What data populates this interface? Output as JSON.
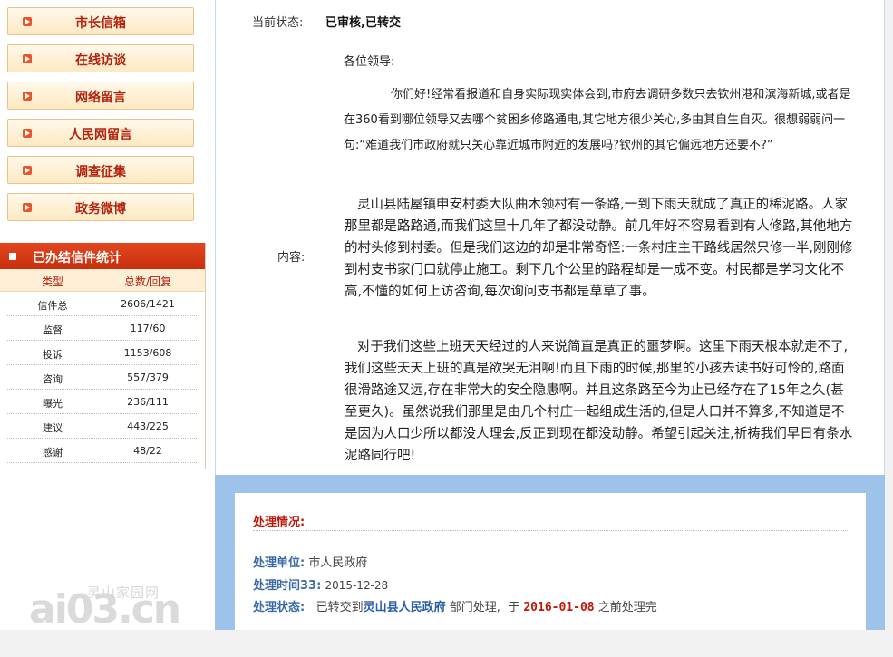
{
  "sidebar": {
    "nav": [
      {
        "label": "市长信箱"
      },
      {
        "label": "在线访谈"
      },
      {
        "label": "网络留言"
      },
      {
        "label": "人民网留言"
      },
      {
        "label": "调查征集"
      },
      {
        "label": "政务微博"
      }
    ],
    "stats": {
      "title": "已办结信件统计",
      "col_type": "类型",
      "col_total": "总数/回复",
      "rows": [
        {
          "type": "信件总",
          "value": "2606/1421"
        },
        {
          "type": "监督",
          "value": "117/60"
        },
        {
          "type": "投诉",
          "value": "1153/608"
        },
        {
          "type": "咨询",
          "value": "557/379"
        },
        {
          "type": "曝光",
          "value": "236/111"
        },
        {
          "type": "建议",
          "value": "443/225"
        },
        {
          "type": "感谢",
          "value": "48/22"
        }
      ]
    }
  },
  "letter": {
    "status_label": "当前状态:",
    "status_value": "已审核,已转交",
    "content_label": "内容:",
    "greeting": "各位领导:",
    "para1": "你们好!经常看报道和自身实际现实体会到,市府去调研多数只去钦州港和滨海新城,或者是在360看到哪位领导又去哪个贫困乡修路通电,其它地方很少关心,多由其自生自灭。很想弱弱问一句:“难道我们市政府就只关心靠近城市附近的发展吗?钦州的其它偏远地方还要不?”",
    "para2": "灵山县陆屋镇申安村委大队曲木领村有一条路,一到下雨天就成了真正的稀泥路。人家那里都是路路通,而我们这里十几年了都没动静。前几年好不容易看到有人修路,其他地方的村头修到村委。但是我们这边的却是非常奇怪:一条村庄主干路线居然只修一半,刚刚修到村支书家门口就停止施工。剩下几个公里的路程却是一成不变。村民都是学习文化不高,不懂的如何上访咨询,每次询问支书都是草草了事。",
    "para3": "对于我们这些上班天天经过的人来说简直是真正的噩梦啊。这里下雨天根本就走不了,我们这些天天上班的真是欲哭无泪啊!而且下雨的时候,那里的小孩去读书好可怜的,路面很滑路途又远,存在非常大的安全隐患啊。并且这条路至今为止已经存在了15年之久(甚至更久)。虽然说我们那里是由几个村庄一起组成生活的,但是人口并不算多,不知道是不是因为人口少所以都没人理会,反正到现在都没动静。希望引起关注,祈祷我们早日有条水泥路同行吧!"
  },
  "processing": {
    "title": "处理情况:",
    "unit_label": "处理单位:",
    "unit_value": "市人民政府",
    "time_label": "处理时间33:",
    "time_value": "2015-12-28",
    "status_label": "处理状态:",
    "status_prefix": "已转交到",
    "status_dept": "灵山县人民政府",
    "status_mid": "部门处理,",
    "status_before": "于",
    "status_date": "2016-01-08",
    "status_suffix": "之前处理完"
  },
  "watermark": {
    "small": "灵山家园网",
    "big": "ai03.cn"
  }
}
